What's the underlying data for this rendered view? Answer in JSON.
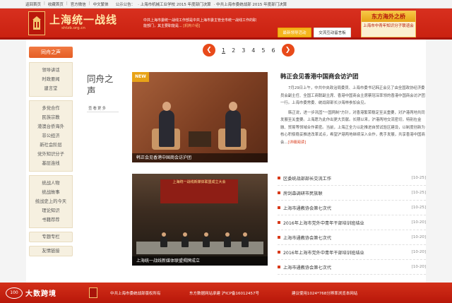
{
  "topbar": {
    "links": [
      "返回首页",
      "收藏首页",
      "官方微信",
      "中文繁体"
    ],
    "notice_label": "公示公告：",
    "notices": [
      "· 上海市机械工业学校 2015 年度部门决算",
      "· 中共上海市委统战部 2015 年度部门决算"
    ]
  },
  "header": {
    "logo_title": "上海统一战线",
    "logo_url": "shtzb.org.cn",
    "desc": "中共上海市委统一战线工作部是中共上海市委主管全市统一战线工作的职能部门，其主要职能是...",
    "desc_more": "[机构介绍]",
    "btn_active": "最新领导活动",
    "btn_other": "交流互动留言板",
    "promo_title": "东方海外之桥",
    "promo_sub": "上海市中青年知识分子联谊会"
  },
  "pager": {
    "prev": "❮",
    "next": "❯",
    "pages": [
      "1",
      "2",
      "3",
      "4",
      "5",
      "6"
    ]
  },
  "leftnav": {
    "head": "同舟之声",
    "group1": [
      "领导讲话",
      "时政要闻",
      "建言堂"
    ],
    "group2": [
      "多党合作",
      "民族宗教",
      "港澳台侨海外",
      "非公经济",
      "新社会阶层",
      "党外知识分子",
      "基层连线"
    ],
    "group3": [
      "统战人物",
      "统战故事",
      "统战史上的今天",
      "理论知识",
      "书籍荐荐"
    ],
    "pills": [
      "专题专栏",
      "友情链接"
    ]
  },
  "section": {
    "title": "同舟之声",
    "more": "查看更多"
  },
  "photo1": {
    "badge": "NEW",
    "caption": "韩正会见香港中国商会访沪团"
  },
  "photo2": {
    "banner": "上海统一战线新媒体联盟成立大会",
    "caption": "上海统一战线新媒体联盟揭牌成立"
  },
  "article": {
    "title": "韩正会见香港中国商会访沪团",
    "p1": "7月29日上午，中共中央政治局委员、上海市委书记韩正会见了由全国政协经济委员会副主任、全国工商联副主席、香港中国商会主席蔡冠深率领的香港中国商会访沪团一行。上海市委常委、统战部部长沙海林参加会见。",
    "p2": "韩正说，进一步巩固\"一国两制\"方针，对香港繁荣稳定至关重要，对沪港两地共同发展至关重要。上海愿为此作出更大贡献。长期以来，沪港两地交流密切，特别在金融、贸易等领域合作紧密。当前，上海正全力以赴推进自贸试验区建设，以制度创新为核心积极稳妥推进改革试点，希望沪港两地继续深入合作，携手发展，共享香港中国商会...",
    "detail": "[详细阅读]"
  },
  "news": [
    {
      "title": "区委统战部部长交流工作",
      "date": "[10-25]"
    },
    {
      "title": "房剑森调研市民族联",
      "date": "[10-25]"
    },
    {
      "title": "上海市通教协会第七次代",
      "date": "[10-25]"
    },
    {
      "title": "2016年上海市党外中青年干部培训班结业",
      "date": "[10-20]"
    },
    {
      "title": "上海市通教协会第七次代",
      "date": "[10-20]"
    },
    {
      "title": "2016年上海市党外中青年干部培训班结业",
      "date": "[10-20]"
    },
    {
      "title": "上海市通教协会第七次代",
      "date": "[10-20]"
    }
  ],
  "footer": {
    "wm_mark": "100",
    "wm_text": "大数跨境",
    "copyright": "中共上海市委统战部版权所有",
    "icp": "东方数据网站承建 沪ICP备16012457号",
    "hint": "建议使用1024*768分辨率浏览本网站"
  }
}
